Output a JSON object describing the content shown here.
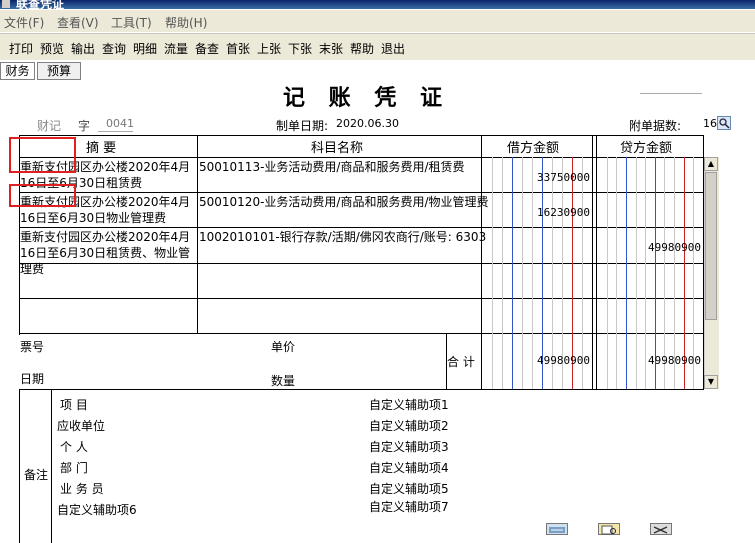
{
  "window": {
    "title": "联查凭证"
  },
  "menu": [
    "文件(F)",
    "查看(V)",
    "工具(T)",
    "帮助(H)"
  ],
  "toolbar": [
    "打印",
    "预览",
    "输出",
    "查询",
    "明细",
    "流量",
    "备查",
    "首张",
    "上张",
    "下张",
    "末张",
    "帮助",
    "退出"
  ],
  "tabs": [
    "财务",
    "预算"
  ],
  "voucher": {
    "title": "记 账 凭 证",
    "type_label": "财记",
    "zi_label": "字",
    "number": "0041",
    "date_label": "制单日期:",
    "date": "2020.06.30",
    "attach_label": "附单据数:",
    "attach_count": "16"
  },
  "columns": {
    "summary": "摘  要",
    "account": "科目名称",
    "debit": "借方金额",
    "credit": "贷方金额"
  },
  "rows": [
    {
      "summary": "重新支付园区办公楼2020年4月16日至6月30日租赁费",
      "account": "50010113-业务活动费用/商品和服务费用/租赁费",
      "debit": "33750000",
      "credit": ""
    },
    {
      "summary": "重新支付园区办公楼2020年4月16日至6月30日物业管理费",
      "account": "50010120-业务活动费用/商品和服务费用/物业管理费",
      "debit": "16230900",
      "credit": ""
    },
    {
      "summary": "重新支付园区办公楼2020年4月16日至6月30日租赁费、物业管理费",
      "account": "1002010101-银行存款/活期/佛冈农商行/账号: 6303",
      "debit": "",
      "credit": "49980900"
    }
  ],
  "footer": {
    "ticket_no": "票号",
    "date": "日期",
    "unit_price": "单价",
    "quantity": "数量",
    "total_label": "合 计",
    "total_debit": "49980900",
    "total_credit": "49980900"
  },
  "remarks": {
    "label": "备注",
    "left": [
      "项    目",
      "应收单位",
      "个    人",
      "部    门",
      "业 务 员",
      "自定义辅助项6"
    ],
    "right": [
      "自定义辅助项1",
      "自定义辅助项2",
      "自定义辅助项3",
      "自定义辅助项4",
      "自定义辅助项5",
      "自定义辅助项7"
    ]
  },
  "icons": [
    "info-icon",
    "preview-icon",
    "tools-icon"
  ],
  "colors": {
    "highlight": "#e02020",
    "blue_grid": "#3355cc",
    "red_grid": "#cc2222"
  }
}
